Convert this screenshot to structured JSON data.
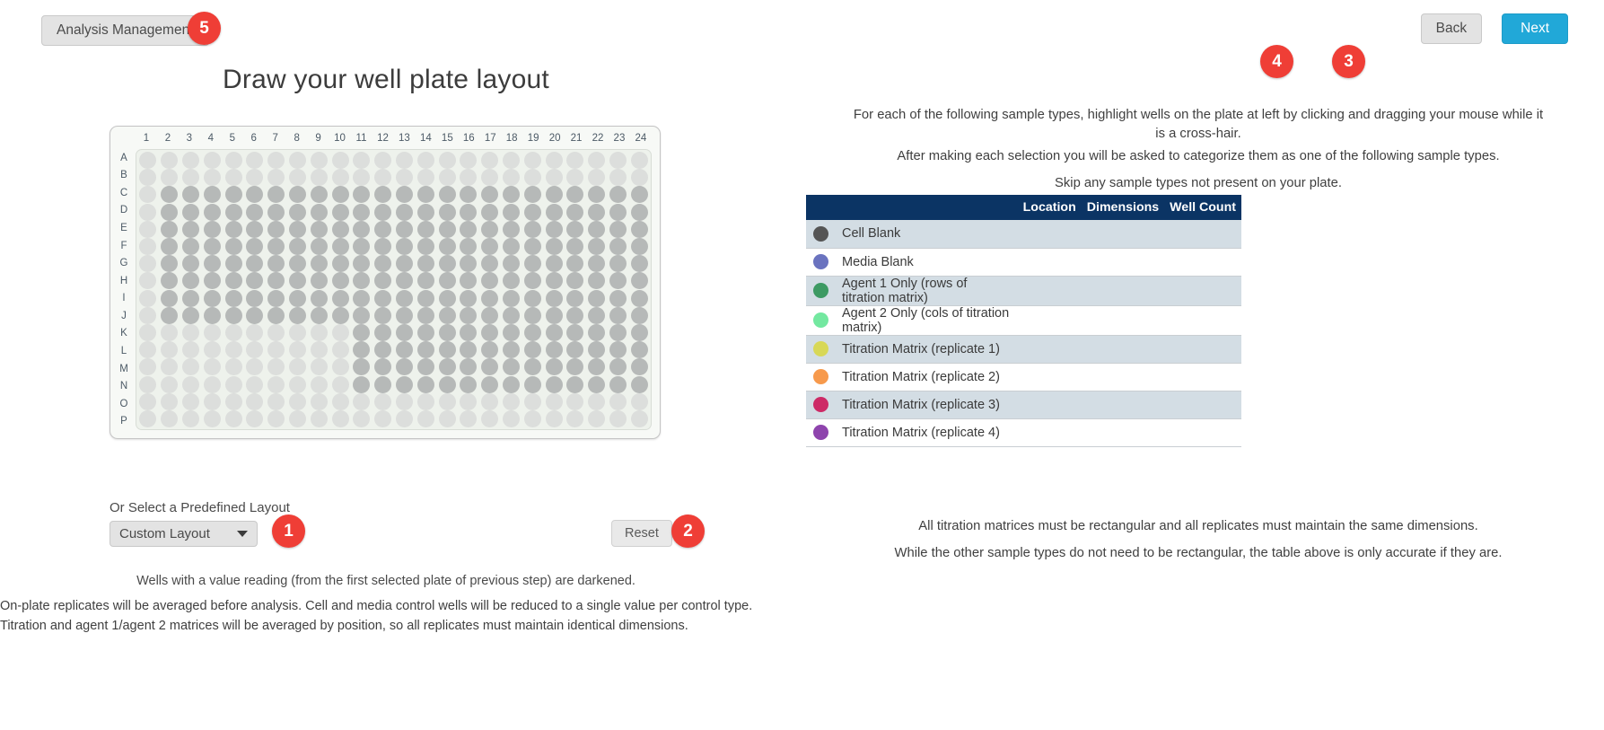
{
  "topbar": {
    "analysis_management_label": "Analysis Management",
    "back_label": "Back",
    "next_label": "Next"
  },
  "annotations": {
    "b1": "1",
    "b2": "2",
    "b3": "3",
    "b4": "4",
    "b5": "5"
  },
  "left": {
    "title": "Draw your well plate layout",
    "select_label": "Or Select a Predefined Layout",
    "select_value": "Custom Layout",
    "reset_label": "Reset",
    "note_center": "Wells with a value reading (from the first selected plate of previous step) are darkened.",
    "note_block": "On-plate replicates will be averaged before analysis. Cell and media control wells will be reduced to a single value per control type. Titration and agent 1/agent 2 matrices will be averaged by position, so all replicates must maintain identical dimensions."
  },
  "plate": {
    "col_labels": [
      "1",
      "2",
      "3",
      "4",
      "5",
      "6",
      "7",
      "8",
      "9",
      "10",
      "11",
      "12",
      "13",
      "14",
      "15",
      "16",
      "17",
      "18",
      "19",
      "20",
      "21",
      "22",
      "23",
      "24"
    ],
    "row_labels": [
      "A",
      "B",
      "C",
      "D",
      "E",
      "F",
      "G",
      "H",
      "I",
      "J",
      "K",
      "L",
      "M",
      "N",
      "O",
      "P"
    ],
    "darkened_rows": [
      "000000000000000000000000",
      "000000000000000000000000",
      "011111111111111111111111",
      "011111111111111111111111",
      "011111111111111111111111",
      "011111111111111111111111",
      "011111111111111111111111",
      "011111111111111111111111",
      "011111111111111111111111",
      "011111111111111111111111",
      "000000000011111111111111",
      "000000000011111111111111",
      "000000000011111111111111",
      "000000000011111111111111",
      "000000000000000000000000",
      "000000000000000000000000"
    ]
  },
  "right": {
    "p1": "For each of the following sample types, highlight wells on the plate at left by clicking and dragging your mouse while it is a cross-hair.",
    "p2": "After making each selection you will be asked to categorize them as one of the following sample types.",
    "p3": "Skip any sample types not present on your plate.",
    "table": {
      "headers": [
        "",
        "",
        "Location",
        "Dimensions",
        "Well Count"
      ],
      "rows": [
        {
          "color": "#555555",
          "label": "Cell Blank",
          "location": "",
          "dimensions": "",
          "well_count": ""
        },
        {
          "color": "#6a73bf",
          "label": "Media Blank",
          "location": "",
          "dimensions": "",
          "well_count": ""
        },
        {
          "color": "#3d9a63",
          "label": "Agent 1 Only (rows of titration matrix)",
          "location": "",
          "dimensions": "",
          "well_count": ""
        },
        {
          "color": "#73e8a0",
          "label": "Agent 2 Only (cols of titration matrix)",
          "location": "",
          "dimensions": "",
          "well_count": ""
        },
        {
          "color": "#d8d857",
          "label": "Titration Matrix (replicate 1)",
          "location": "",
          "dimensions": "",
          "well_count": ""
        },
        {
          "color": "#f79a4c",
          "label": "Titration Matrix (replicate 2)",
          "location": "",
          "dimensions": "",
          "well_count": ""
        },
        {
          "color": "#cd2a66",
          "label": "Titration Matrix (replicate 3)",
          "location": "",
          "dimensions": "",
          "well_count": ""
        },
        {
          "color": "#8e44ad",
          "label": "Titration Matrix (replicate 4)",
          "location": "",
          "dimensions": "",
          "well_count": ""
        }
      ]
    },
    "foot1": "All titration matrices must be rectangular and all replicates must maintain the same dimensions.",
    "foot2": "While the other sample types do not need to be rectangular, the table above is only accurate if they are."
  }
}
